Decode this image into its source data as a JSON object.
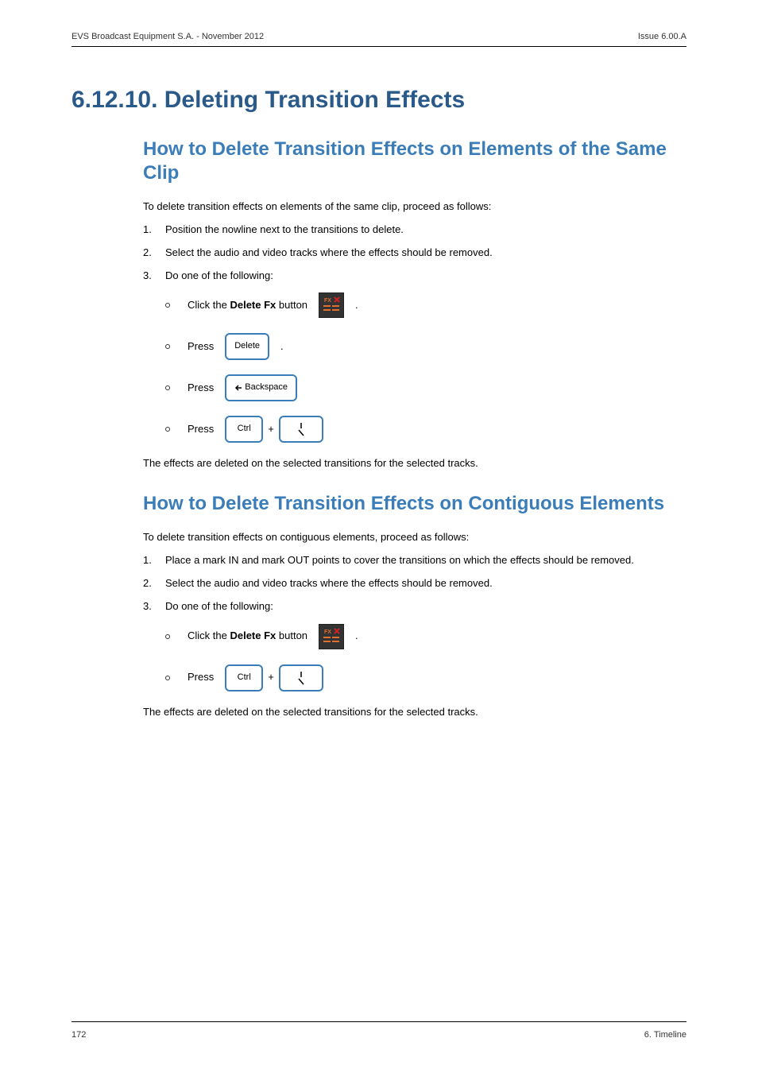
{
  "header": {
    "left": "EVS Broadcast Equipment S.A. - November 2012",
    "right": "Issue 6.00.A"
  },
  "h1": "6.12.10. Deleting Transition Effects",
  "section1": {
    "h2": "How to Delete Transition Effects on Elements of the Same Clip",
    "intro": "To delete transition effects on elements of the same clip, proceed as follows:",
    "steps": {
      "n1": "1.",
      "t1": "Position the nowline next to the transitions to delete.",
      "n2": "2.",
      "t2": "Select the audio and video tracks where the effects should be removed.",
      "n3": "3.",
      "t3": "Do one of the following:"
    },
    "sub": {
      "clickThe": "Click the ",
      "deleteFx": "Delete Fx",
      "buttonWord": " button ",
      "dot": ".",
      "press": "Press ",
      "plus": "+"
    },
    "keys": {
      "delete": "Delete",
      "backspace": "Backspace",
      "ctrl": "Ctrl"
    },
    "after": "The effects are deleted on the selected transitions for the selected tracks."
  },
  "section2": {
    "h2": "How to Delete Transition Effects on Contiguous Elements",
    "intro": "To delete transition effects on contiguous elements, proceed as follows:",
    "steps": {
      "n1": "1.",
      "t1": "Place a mark IN and mark OUT points to cover the transitions on which the effects should be removed.",
      "n2": "2.",
      "t2": "Select the audio and video tracks where the effects should be removed.",
      "n3": "3.",
      "t3": "Do one of the following:"
    },
    "after": "The effects are deleted on the selected transitions for the selected tracks."
  },
  "footer": {
    "left": "172",
    "right": "6. Timeline"
  },
  "icons": {
    "fx": "fx-delete-icon",
    "backslash": "backslash-key-icon"
  }
}
